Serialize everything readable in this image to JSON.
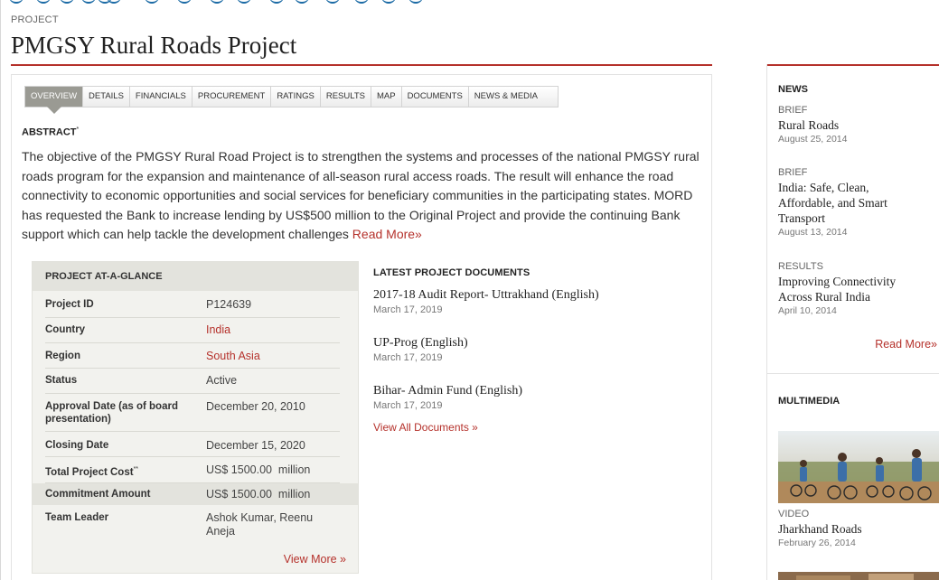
{
  "header": {
    "kicker": "PROJECT",
    "title": "PMGSY Rural Roads Project"
  },
  "tabs": [
    {
      "label": "OVERVIEW",
      "active": true
    },
    {
      "label": "DETAILS"
    },
    {
      "label": "FINANCIALS"
    },
    {
      "label": "PROCUREMENT"
    },
    {
      "label": "RATINGS"
    },
    {
      "label": "RESULTS"
    },
    {
      "label": "MAP"
    },
    {
      "label": "DOCUMENTS"
    },
    {
      "label": "NEWS & MEDIA"
    }
  ],
  "abstract": {
    "heading": "ABSTRACT",
    "heading_mark": "*",
    "text": "The objective of the PMGSY Rural Road Project is to strengthen the systems and processes of the national PMGSY rural roads program for the expansion and maintenance of all-season rural access roads. The result will enhance the road connectivity to economic opportunities and social services for beneficiary communities in the participating states. MORD has requested the Bank to increase lending by US$500 million to the Original Project and provide the continuing Bank support which can help tackle the development challenges ",
    "read_more": "Read More»"
  },
  "glance": {
    "heading": "PROJECT AT-A-GLANCE",
    "rows": {
      "project_id": {
        "label": "Project ID",
        "value": "P124639"
      },
      "country": {
        "label": "Country",
        "value": "India"
      },
      "region": {
        "label": "Region",
        "value": "South Asia"
      },
      "status": {
        "label": "Status",
        "value": "Active"
      },
      "approval": {
        "label": "Approval Date (as of board presentation)",
        "value": "December 20, 2010"
      },
      "closing": {
        "label": "Closing Date",
        "value": "December 15, 2020"
      },
      "cost": {
        "label": "Total Project Cost",
        "label_mark": "**",
        "value": "US$ 1500.00  million"
      },
      "commitment": {
        "label": "Commitment Amount",
        "value": "US$ 1500.00  million"
      },
      "leader": {
        "label": "Team Leader",
        "value": "Ashok Kumar, Reenu Aneja"
      }
    },
    "view_more": "View More »"
  },
  "documents": {
    "heading": "LATEST PROJECT DOCUMENTS",
    "items": [
      {
        "title": "2017-18 Audit Report- Uttrakhand (English)",
        "date": "March 17, 2019"
      },
      {
        "title": "UP-Prog (English)",
        "date": "March 17, 2019"
      },
      {
        "title": "Bihar- Admin Fund (English)",
        "date": "March 17, 2019"
      }
    ],
    "view_all": "View All Documents »"
  },
  "sidebar": {
    "news_heading": "NEWS",
    "news": [
      {
        "kind": "BRIEF",
        "title": "Rural Roads",
        "date": "August 25, 2014"
      },
      {
        "kind": "BRIEF",
        "title": "India: Safe, Clean, Affordable, and Smart Transport",
        "date": "August 13, 2014"
      },
      {
        "kind": "RESULTS",
        "title": "Improving Connectivity Across Rural India",
        "date": "April 10, 2014"
      }
    ],
    "read_more": "Read More»",
    "multimedia_heading": "MULTIMEDIA",
    "video": {
      "kind": "VIDEO",
      "title": "Jharkhand Roads",
      "date": "February 26, 2014"
    }
  }
}
